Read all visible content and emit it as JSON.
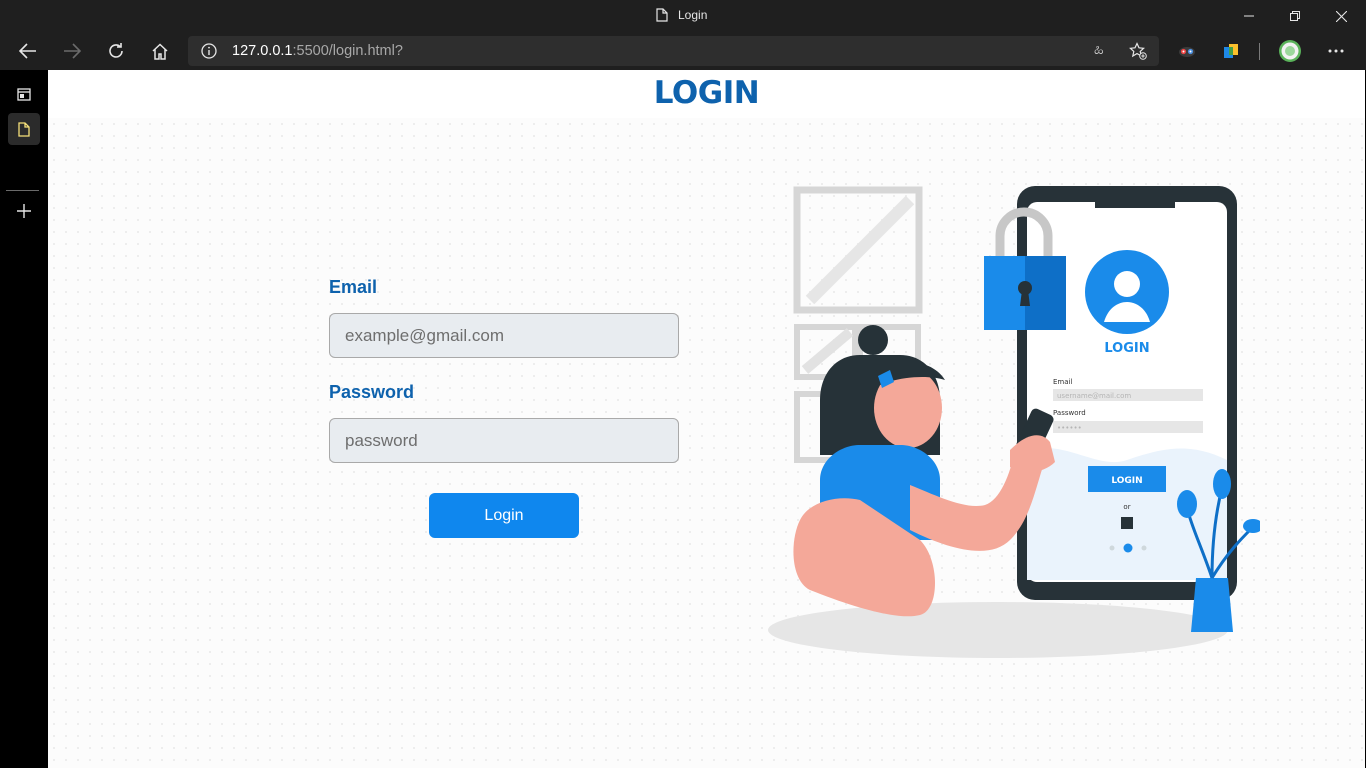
{
  "browser": {
    "tab_title": "Login",
    "url_host": "127.0.0.1",
    "url_rest": ":5500/login.html?",
    "read_aloud_glyph": "ಹಿ"
  },
  "page": {
    "title": "LOGIN",
    "form": {
      "email_label": "Email",
      "email_placeholder": "example@gmail.com",
      "password_label": "Password",
      "password_placeholder": "password",
      "submit_label": "Login"
    },
    "illustration": {
      "phone_title": "LOGIN",
      "email_label": "Email",
      "email_placeholder": "username@mail.com",
      "password_label": "Password",
      "password_dots": "••••••",
      "button_label": "LOGIN",
      "or_text": "or"
    }
  },
  "colors": {
    "brand": "#0e62ad",
    "button": "#0f87ee",
    "illustration_blue": "#1a8bea"
  },
  "icons": [
    "back-icon",
    "forward-icon",
    "refresh-icon",
    "home-icon",
    "info-icon",
    "favorites-icon",
    "extension-icon",
    "profile-avatar",
    "more-icon",
    "minimize-icon",
    "restore-icon",
    "close-icon",
    "document-icon",
    "plus-icon"
  ]
}
